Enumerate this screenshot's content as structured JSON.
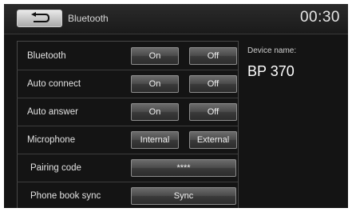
{
  "header": {
    "title": "Bluetooth",
    "time": "00:30",
    "back_icon": "back-arrow-icon"
  },
  "settings": [
    {
      "label": "Bluetooth",
      "options": [
        "On",
        "Off"
      ]
    },
    {
      "label": "Auto connect",
      "options": [
        "On",
        "Off"
      ]
    },
    {
      "label": "Auto answer",
      "options": [
        "On",
        "Off"
      ]
    },
    {
      "label": "Microphone",
      "options": [
        "Internal",
        "External"
      ]
    },
    {
      "label": "Pairing code",
      "value": "****"
    },
    {
      "label": "Phone book sync",
      "action": "Sync"
    }
  ],
  "device": {
    "label": "Device name:",
    "name": "BP 370"
  },
  "colors": {
    "background": "#141414",
    "button_top": "#6b6b6b",
    "button_bottom": "#2c2c2c",
    "text": "#e2e2e2"
  }
}
